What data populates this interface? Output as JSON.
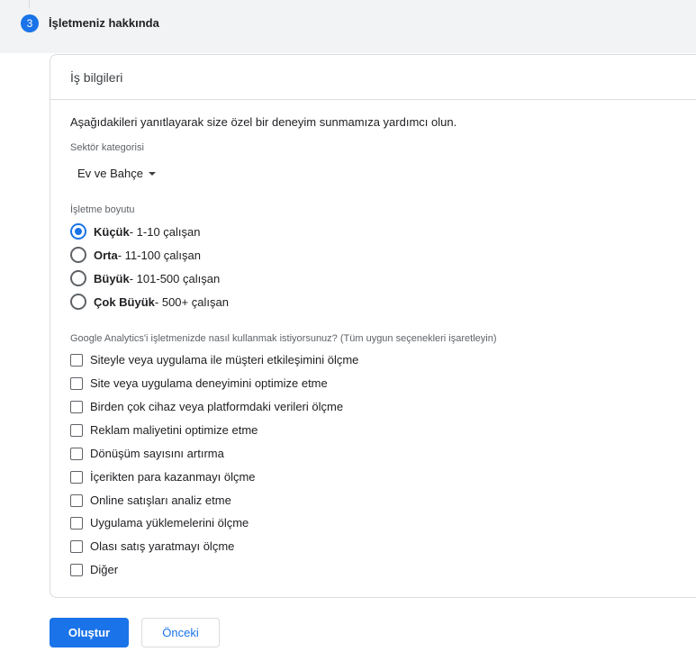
{
  "step": {
    "number": "3",
    "title": "İşletmeniz hakkında"
  },
  "card": {
    "header": "İş bilgileri",
    "intro": "Aşağıdakileri yanıtlayarak size özel bir deneyim sunmamıza yardımcı olun.",
    "sector": {
      "label": "Sektör kategorisi",
      "selected": "Ev ve Bahçe"
    },
    "size": {
      "label": "İşletme boyutu",
      "options": [
        {
          "name": "Küçük",
          "range": " - 1-10 çalışan",
          "checked": true
        },
        {
          "name": "Orta",
          "range": " - 11-100 çalışan",
          "checked": false
        },
        {
          "name": "Büyük",
          "range": " - 101-500 çalışan",
          "checked": false
        },
        {
          "name": "Çok Büyük",
          "range": " - 500+ çalışan",
          "checked": false
        }
      ]
    },
    "usage": {
      "label": "Google Analytics'i işletmenizde nasıl kullanmak istiyorsunuz? (Tüm uygun seçenekleri işaretleyin)",
      "options": [
        "Siteyle veya uygulama ile müşteri etkileşimini ölçme",
        "Site veya uygulama deneyimini optimize etme",
        "Birden çok cihaz veya platformdaki verileri ölçme",
        "Reklam maliyetini optimize etme",
        "Dönüşüm sayısını artırma",
        "İçerikten para kazanmayı ölçme",
        "Online satışları analiz etme",
        "Uygulama yüklemelerini ölçme",
        "Olası satış yaratmayı ölçme",
        "Diğer"
      ]
    }
  },
  "buttons": {
    "create": "Oluştur",
    "previous": "Önceki"
  },
  "colors": {
    "accent": "#1a73e8",
    "band": "#f1f3f4",
    "border": "#dadce0"
  }
}
